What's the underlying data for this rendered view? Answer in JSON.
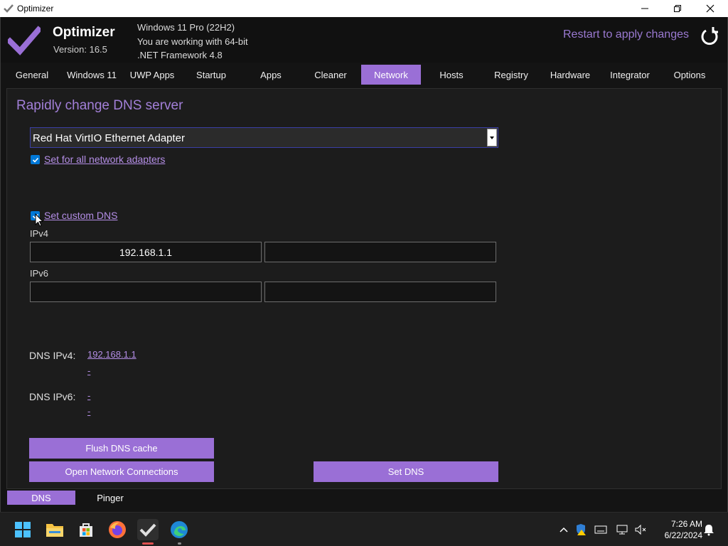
{
  "window": {
    "title": "Optimizer"
  },
  "header": {
    "app_name": "Optimizer",
    "version": "Version: 16.5",
    "sysinfo": [
      "Windows 11 Pro (22H2)",
      "You are working with 64-bit",
      ".NET Framework 4.8"
    ],
    "restart_label": "Restart to apply changes"
  },
  "tabs": [
    {
      "label": "General"
    },
    {
      "label": "Windows 11"
    },
    {
      "label": "UWP Apps"
    },
    {
      "label": "Startup"
    },
    {
      "label": "Apps"
    },
    {
      "label": "Cleaner"
    },
    {
      "label": "Network",
      "active": true
    },
    {
      "label": "Hosts"
    },
    {
      "label": "Registry"
    },
    {
      "label": "Hardware"
    },
    {
      "label": "Integrator"
    },
    {
      "label": "Options"
    }
  ],
  "dns": {
    "heading": "Rapidly change DNS server",
    "adapter_selected": "Red Hat VirtIO Ethernet Adapter",
    "all_adapters_label": "Set for all network adapters",
    "all_adapters_checked": true,
    "custom_dns_label": "Set custom DNS",
    "custom_dns_checked": true,
    "ipv4_label": "IPv4",
    "ipv4_primary": "192.168.1.1",
    "ipv4_secondary": "",
    "ipv6_label": "IPv6",
    "ipv6_primary": "",
    "ipv6_secondary": "",
    "current_ipv4_label": "DNS IPv4:",
    "current_ipv4_values": [
      "192.168.1.1",
      "-"
    ],
    "current_ipv6_label": "DNS IPv6:",
    "current_ipv6_values": [
      "-",
      "-"
    ],
    "flush_label": "Flush DNS cache",
    "open_connections_label": "Open Network Connections",
    "set_dns_label": "Set DNS"
  },
  "subtabs": [
    {
      "label": "DNS",
      "active": true
    },
    {
      "label": "Pinger"
    }
  ],
  "taskbar": {
    "items": [
      "windows-start-icon",
      "file-explorer-icon",
      "microsoft-store-icon",
      "firefox-icon",
      "optimizer-icon",
      "edge-icon"
    ],
    "time": "7:26 AM",
    "date": "6/22/2024"
  },
  "colors": {
    "accent": "#9a6fd6",
    "heading": "#a27fd8",
    "link": "#b48ee6",
    "background": "#1c1c1c"
  }
}
